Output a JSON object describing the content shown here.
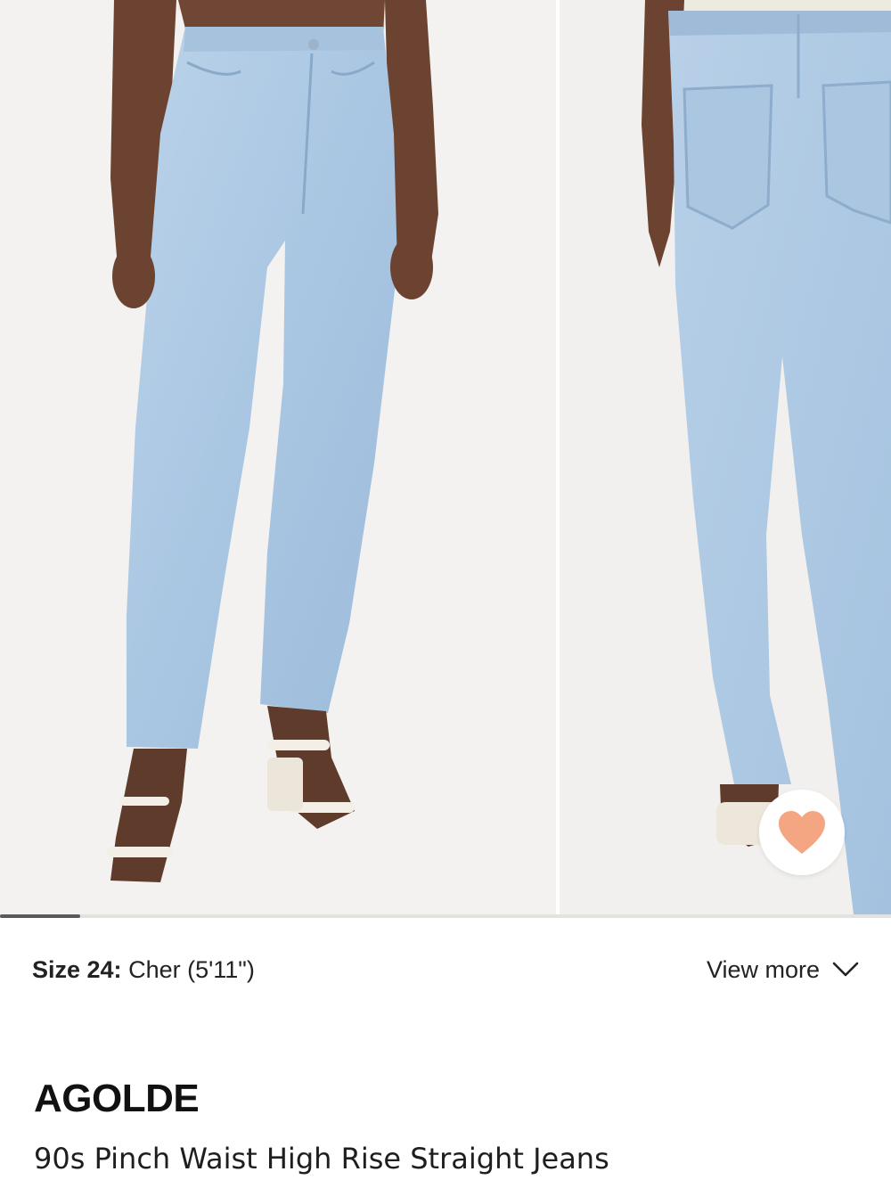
{
  "gallery": {
    "images": [
      {
        "icon": "model-front-jeans-photo"
      },
      {
        "icon": "model-back-jeans-photo"
      }
    ],
    "progress": 0.09,
    "favorite_icon": "heart-icon",
    "favorite_color": "#f4a582"
  },
  "model_info": {
    "size_label": "Size 24:",
    "model_text": "Cher (5'11\")",
    "view_more_label": "View more",
    "view_more_icon": "chevron-down-icon"
  },
  "product": {
    "brand": "AGOLDE",
    "name": "90s Pinch Waist High Rise Straight Jeans"
  }
}
